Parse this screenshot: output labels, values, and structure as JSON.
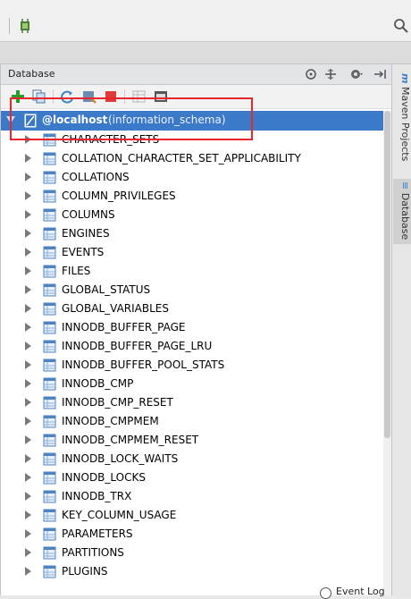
{
  "panel": {
    "title": "Database"
  },
  "sidebar_tabs": [
    "Maven Projects",
    "Database"
  ],
  "root": {
    "name": "@localhost",
    "schema": "(information_schema)"
  },
  "tables": [
    "CHARACTER_SETS",
    "COLLATION_CHARACTER_SET_APPLICABILITY",
    "COLLATIONS",
    "COLUMN_PRIVILEGES",
    "COLUMNS",
    "ENGINES",
    "EVENTS",
    "FILES",
    "GLOBAL_STATUS",
    "GLOBAL_VARIABLES",
    "INNODB_BUFFER_PAGE",
    "INNODB_BUFFER_PAGE_LRU",
    "INNODB_BUFFER_POOL_STATS",
    "INNODB_CMP",
    "INNODB_CMP_RESET",
    "INNODB_CMPMEM",
    "INNODB_CMPMEM_RESET",
    "INNODB_LOCK_WAITS",
    "INNODB_LOCKS",
    "INNODB_TRX",
    "KEY_COLUMN_USAGE",
    "PARAMETERS",
    "PARTITIONS",
    "PLUGINS"
  ],
  "status": {
    "event_log": "Event Log"
  },
  "colors": {
    "selection": "#3b79c9",
    "highlight_box": "#e8262b",
    "add_icon": "#2e9a2e",
    "stop_icon": "#e03b3b"
  }
}
